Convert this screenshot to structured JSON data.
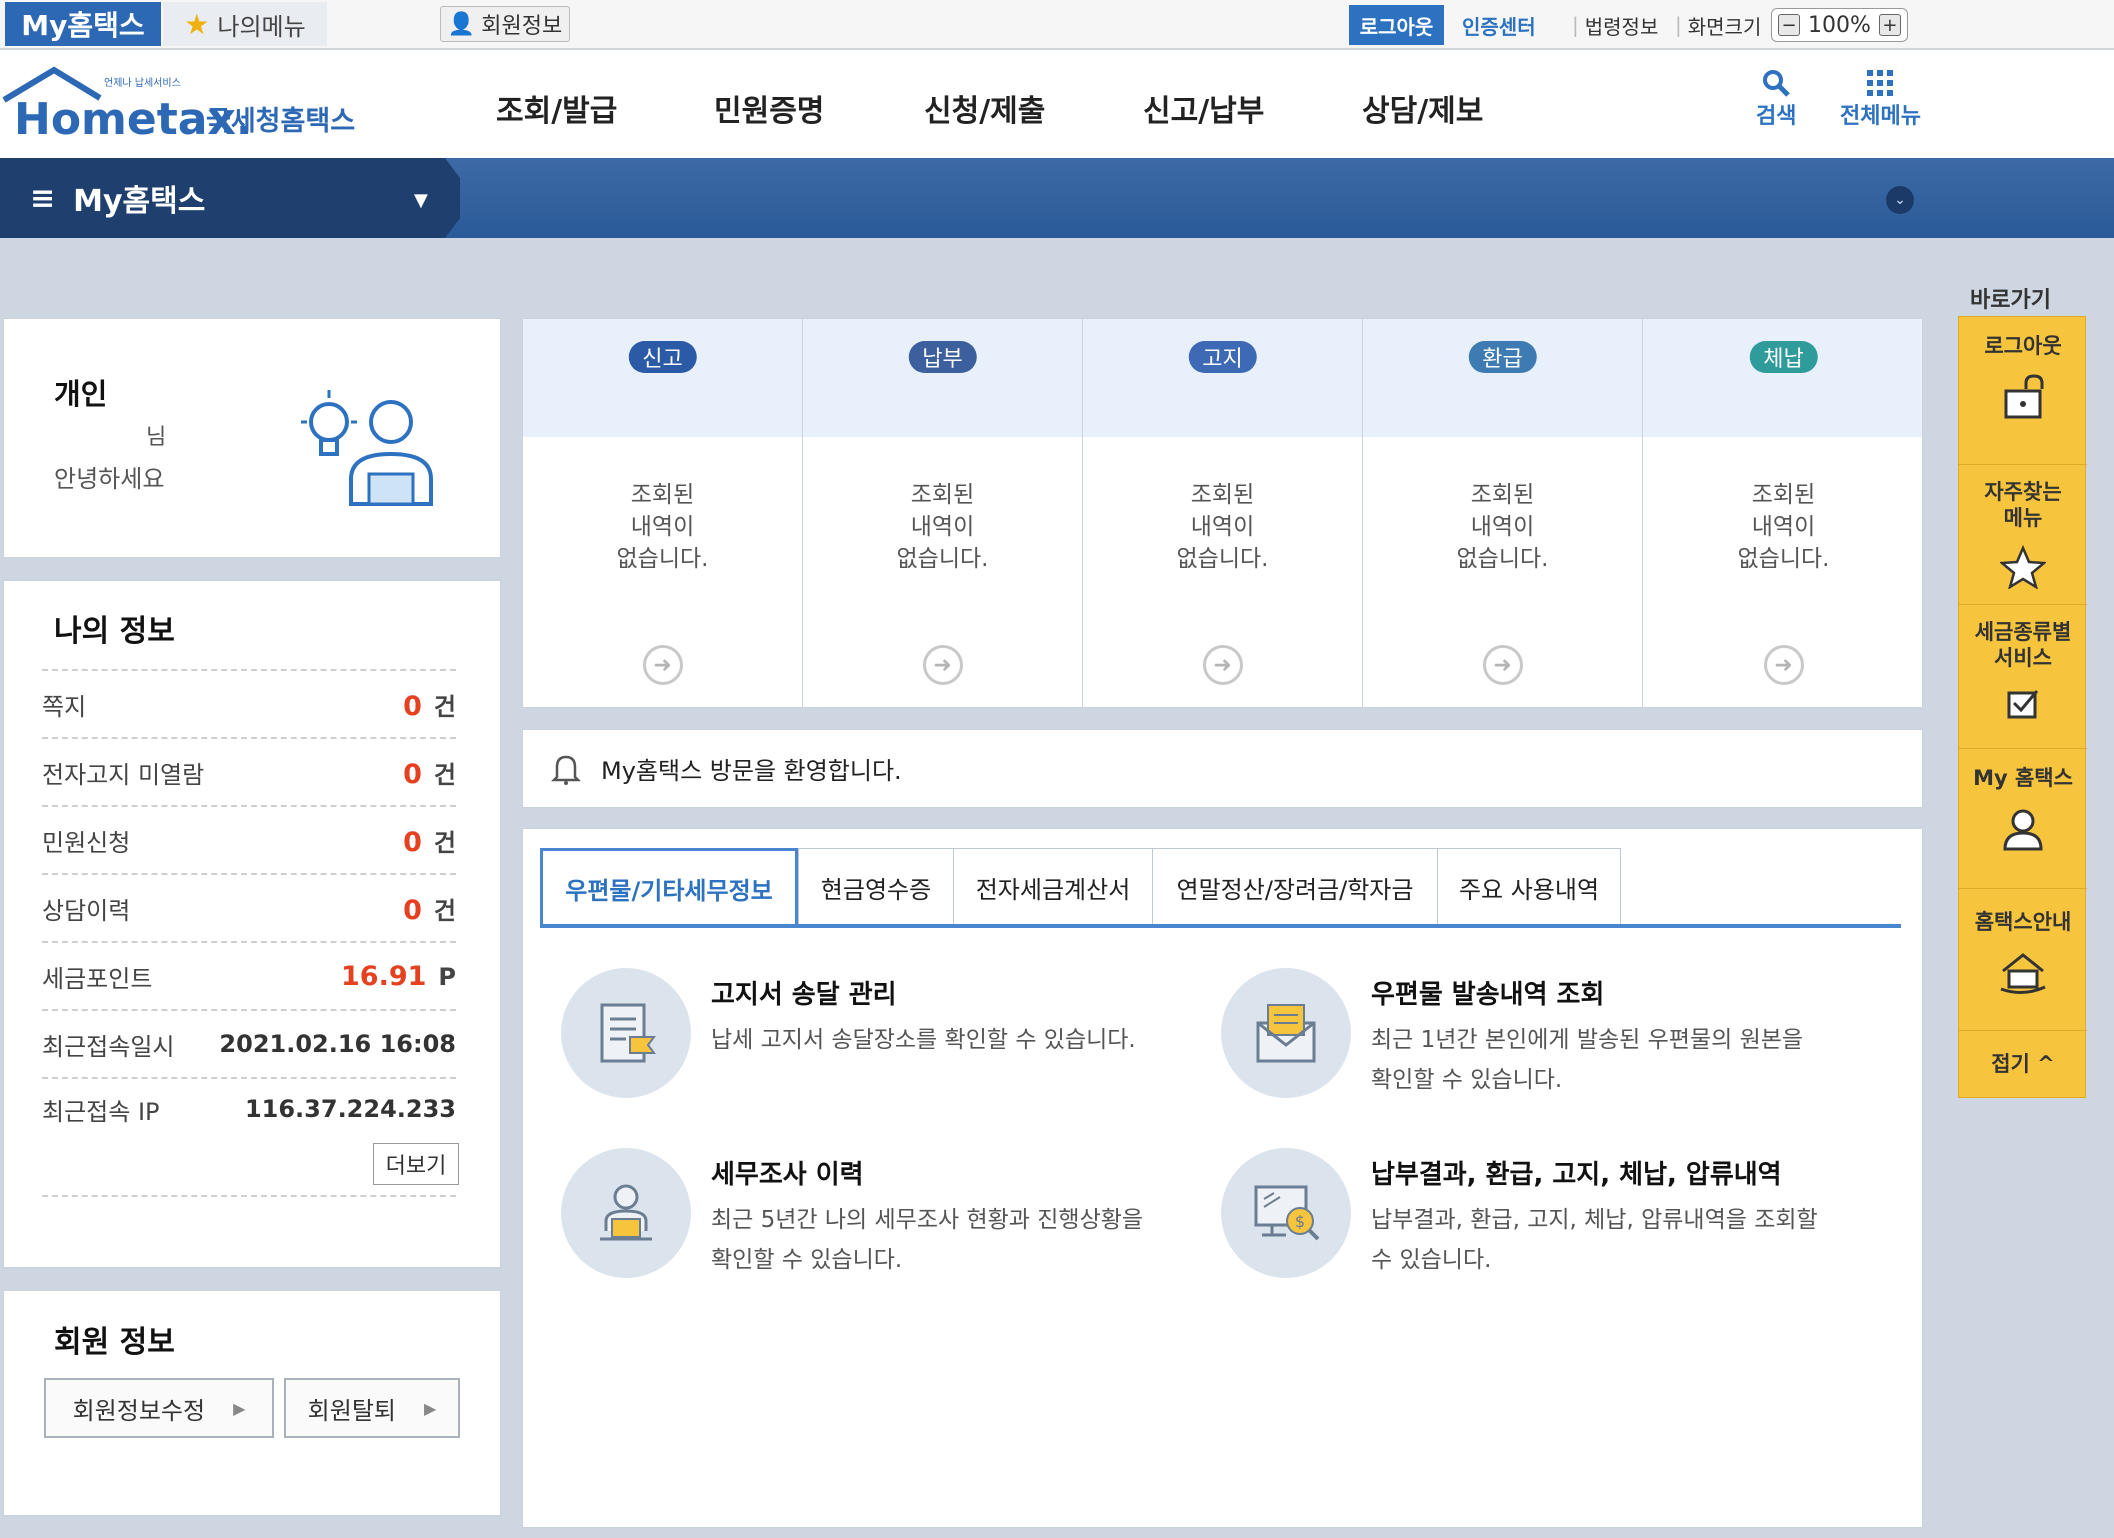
{
  "topbar": {
    "myhometax": "My홈택스",
    "mymenu": "나의메뉴",
    "member_info": "회원정보",
    "logout": "로그아웃",
    "auth_center": "인증센터",
    "law_info": "법령정보",
    "screen_size": "화면크기",
    "zoom": "100%",
    "zoom_out": "−",
    "zoom_in": "+"
  },
  "header": {
    "logo_small": "언제나 납세서비스",
    "logo_text": "Hometax.",
    "logo_kr": "국세청홈택스",
    "gnb": [
      "조회/발급",
      "민원증명",
      "신청/제출",
      "신고/납부",
      "상담/제보"
    ],
    "search": "검색",
    "all_menu": "전체메뉴"
  },
  "navbar": {
    "title": "My홈택스"
  },
  "personal": {
    "type": "개인",
    "name_partial": "님",
    "greeting": "안녕하세요"
  },
  "myinfo": {
    "title": "나의 정보",
    "rows": [
      {
        "label": "쪽지",
        "value": "0",
        "unit": "건"
      },
      {
        "label": "전자고지 미열람",
        "value": "0",
        "unit": "건"
      },
      {
        "label": "민원신청",
        "value": "0",
        "unit": "건"
      },
      {
        "label": "상담이력",
        "value": "0",
        "unit": "건"
      },
      {
        "label": "세금포인트",
        "value": "16.91",
        "unit": "P"
      },
      {
        "label": "최근접속일시",
        "value": "2021.02.16 16:08"
      },
      {
        "label": "최근접속 IP",
        "value": "116.37.224.233"
      }
    ],
    "more": "더보기"
  },
  "member": {
    "title": "회원 정보",
    "edit": "회원정보수정",
    "withdraw": "회원탈퇴"
  },
  "status": {
    "cols": [
      {
        "label": "신고",
        "color": "#2b5aa6",
        "msg1": "조회된",
        "msg2": "내역이",
        "msg3": "없습니다."
      },
      {
        "label": "납부",
        "color": "#3c5f9e",
        "msg1": "조회된",
        "msg2": "내역이",
        "msg3": "없습니다."
      },
      {
        "label": "고지",
        "color": "#3d69b5",
        "msg1": "조회된",
        "msg2": "내역이",
        "msg3": "없습니다."
      },
      {
        "label": "환급",
        "color": "#3e7bb3",
        "msg1": "조회된",
        "msg2": "내역이",
        "msg3": "없습니다."
      },
      {
        "label": "체납",
        "color": "#2f9b9a",
        "msg1": "조회된",
        "msg2": "내역이",
        "msg3": "없습니다."
      }
    ]
  },
  "notice": {
    "text": "My홈택스 방문을 환영합니다."
  },
  "tabs": [
    "우편물/기타세무정보",
    "현금영수증",
    "전자세금계산서",
    "연말정산/장려금/학자금",
    "주요 사용내역"
  ],
  "services": [
    {
      "title": "고지서 송달 관리",
      "desc": "납세 고지서 송달장소를 확인할 수 있습니다."
    },
    {
      "title": "우편물 발송내역 조회",
      "desc": "최근 1년간 본인에게 발송된 우편물의 원본을 확인할 수 있습니다."
    },
    {
      "title": "세무조사 이력",
      "desc": "최근 5년간 나의 세무조사 현황과 진행상황을 확인할 수 있습니다."
    },
    {
      "title": "납부결과, 환급, 고지, 체납, 압류내역",
      "desc": "납부결과, 환급, 고지, 체납, 압류내역을 조회할 수 있습니다."
    }
  ],
  "quick": {
    "title": "바로가기",
    "items": [
      "로그아웃",
      "자주찾는 메뉴",
      "세금종류별 서비스",
      "My 홈택스",
      "홈택스안내"
    ],
    "fold": "접기 ^"
  }
}
